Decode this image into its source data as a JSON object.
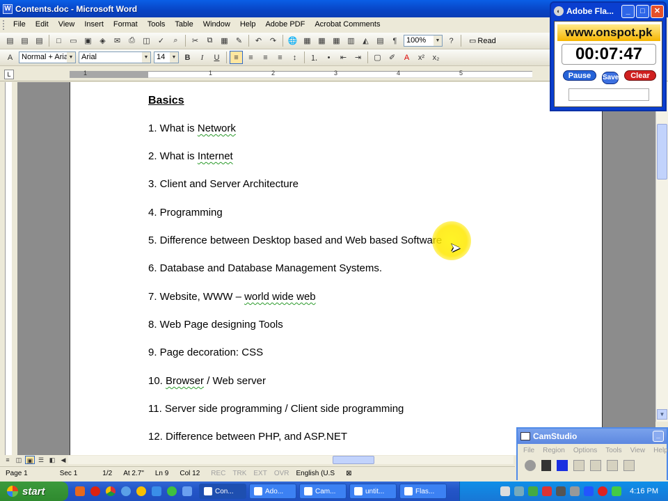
{
  "window": {
    "title": "Contents.doc - Microsoft Word",
    "app_icon": "W"
  },
  "menu": [
    "File",
    "Edit",
    "View",
    "Insert",
    "Format",
    "Tools",
    "Table",
    "Window",
    "Help",
    "Adobe PDF",
    "Acrobat Comments"
  ],
  "toolbar": {
    "zoom": "100%",
    "read_label": "Read"
  },
  "formatting": {
    "style": "Normal + Arial,",
    "font": "Arial",
    "size": "14",
    "bold": "B",
    "italic": "I",
    "underline": "U"
  },
  "ruler": {
    "numbers": [
      "1",
      "1",
      "2",
      "3",
      "4",
      "5"
    ]
  },
  "document": {
    "heading": "Basics",
    "lines": [
      "1. What is Network",
      "2. What is Internet",
      "3. Client and Server Architecture",
      "4. Programming",
      "5. Difference between Desktop based and Web based Software",
      "6. Database and Database Management Systems.",
      "7. Website, WWW – world wide web",
      "8. Web Page designing Tools",
      "9. Page decoration: CSS",
      "10. Browser  /  Web server",
      "11. Server side programming / Client side programming",
      "12.  Difference between PHP, and ASP.NET"
    ],
    "line1_prefix": "1. What is ",
    "line1_word": "Network",
    "line2_prefix": "2. What is ",
    "line2_word": "Internet",
    "line7_prefix": "7. Website, WWW – ",
    "line7_word": "world wide web",
    "line10_prefix": "10. ",
    "line10_word": "Browser",
    "line10_rest": "  /  Web server"
  },
  "status": {
    "page": "Page 1",
    "sec": "Sec 1",
    "pages": "1/2",
    "at": "At 2.7\"",
    "ln": "Ln 9",
    "col": "Col 12",
    "rec": "REC",
    "trk": "TRK",
    "ext": "EXT",
    "ovr": "OVR",
    "lang": "English (U.S"
  },
  "flash": {
    "title": "Adobe Fla...",
    "site": "www.onspot.pk",
    "timer": "00:07:47",
    "pause_label": "Pause",
    "save_label": "Save",
    "clear_label": "Clear"
  },
  "camstudio": {
    "title": "CamStudio",
    "menu": [
      "File",
      "Region",
      "Options",
      "Tools",
      "View",
      "Help"
    ]
  },
  "taskbar": {
    "start_label": "start",
    "tasks": [
      "Con...",
      "Ado...",
      "Cam...",
      "untit...",
      "Flas..."
    ],
    "clock": "4:16 PM"
  }
}
